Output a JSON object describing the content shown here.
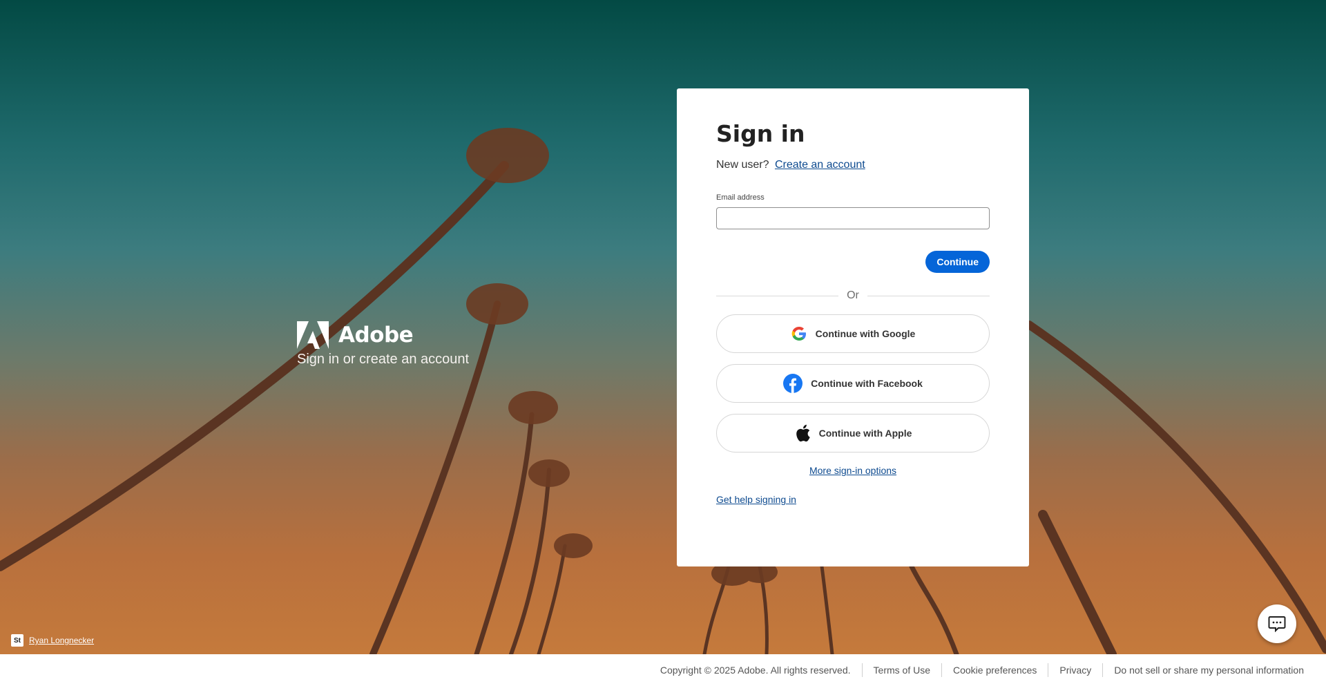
{
  "brand": {
    "name": "Adobe",
    "tagline": "Sign in or create an account",
    "logo_icon": "adobe-logo-icon"
  },
  "signin": {
    "title": "Sign in",
    "new_user_text": "New user?",
    "create_account_link": "Create an account",
    "email_label": "Email address",
    "email_value": "",
    "continue_label": "Continue",
    "or_text": "Or",
    "google_label": "Continue with Google",
    "facebook_label": "Continue with Facebook",
    "apple_label": "Continue with Apple",
    "more_options_link": "More sign-in options",
    "help_link": "Get help signing in"
  },
  "photo_credit": {
    "badge": "St",
    "author": "Ryan Longnecker"
  },
  "footer": {
    "copyright": "Copyright © 2025 Adobe. All rights reserved.",
    "terms": "Terms of Use",
    "cookies": "Cookie preferences",
    "privacy": "Privacy",
    "do_not_sell": "Do not sell or share my personal information"
  },
  "colors": {
    "accent": "#0565d8",
    "link": "#0d4a8f",
    "facebook": "#1877f2"
  },
  "icons": {
    "google": "google-icon",
    "facebook": "facebook-icon",
    "apple": "apple-icon",
    "chat": "chat-icon"
  }
}
